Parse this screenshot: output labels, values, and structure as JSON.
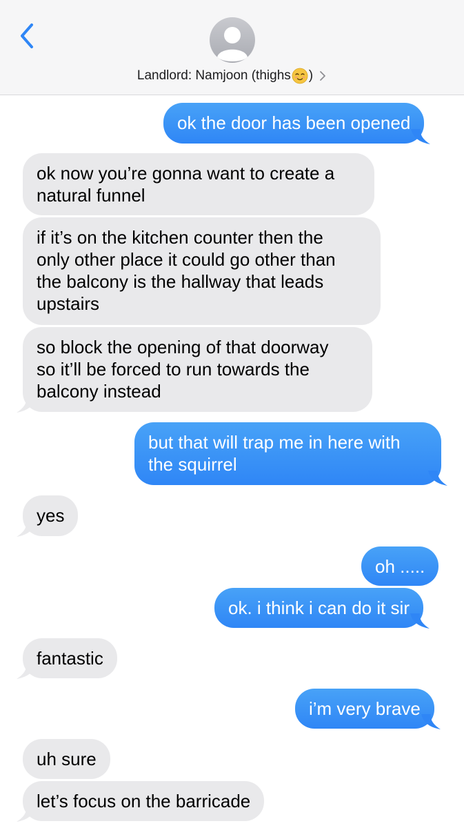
{
  "header": {
    "contact_name": "Landlord: Namjoon (thighs",
    "contact_paren_close": ")",
    "emoji_icon": "relieved-face-emoji-icon",
    "back_icon": "chevron-left-icon",
    "detail_icon": "chevron-right-icon",
    "accent_color": "#2f86f6"
  },
  "messages": [
    {
      "from": "me",
      "lines": [
        "ok the door has been opened"
      ]
    },
    {
      "from": "them",
      "lines": [
        "ok now you’re gonna want to create a",
        "natural funnel"
      ]
    },
    {
      "from": "them",
      "lines": [
        "if it’s on the kitchen counter then the",
        "only other place it could go other than",
        "the balcony is the hallway that leads",
        "upstairs"
      ]
    },
    {
      "from": "them",
      "lines": [
        "so block the opening of that doorway",
        "so it’ll be forced to run towards the",
        "balcony instead"
      ]
    },
    {
      "from": "me",
      "lines": [
        "but that will trap me in here with",
        "the squirrel"
      ]
    },
    {
      "from": "them",
      "lines": [
        "yes"
      ]
    },
    {
      "from": "me",
      "lines": [
        "oh ....."
      ]
    },
    {
      "from": "me",
      "lines": [
        "ok. i think i can do it sir"
      ]
    },
    {
      "from": "them",
      "lines": [
        "fantastic"
      ]
    },
    {
      "from": "me",
      "lines": [
        "i’m very brave"
      ]
    },
    {
      "from": "them",
      "lines": [
        "uh sure"
      ]
    },
    {
      "from": "them",
      "lines": [
        "let’s focus on the barricade"
      ]
    }
  ]
}
